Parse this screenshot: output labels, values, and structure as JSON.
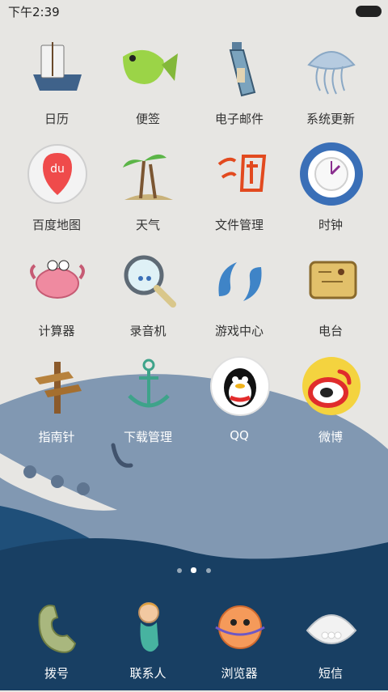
{
  "status_bar": {
    "time": "下午2:39",
    "battery_icon": "battery-icon"
  },
  "apps": [
    {
      "label": "日历",
      "icon": "calendar-boat-icon"
    },
    {
      "label": "便签",
      "icon": "fish-icon"
    },
    {
      "label": "电子邮件",
      "icon": "bottle-icon"
    },
    {
      "label": "系统更新",
      "icon": "jellyfish-icon"
    },
    {
      "label": "百度地图",
      "icon": "baidu-map-icon"
    },
    {
      "label": "天气",
      "icon": "palm-tree-icon"
    },
    {
      "label": "文件管理",
      "icon": "taobao-tao-icon"
    },
    {
      "label": "时钟",
      "icon": "life-ring-clock-icon"
    },
    {
      "label": "计算器",
      "icon": "crab-icon"
    },
    {
      "label": "录音机",
      "icon": "magnifier-icon"
    },
    {
      "label": "游戏中心",
      "icon": "dolphins-icon"
    },
    {
      "label": "电台",
      "icon": "treasure-map-icon"
    },
    {
      "label": "指南针",
      "icon": "signpost-icon"
    },
    {
      "label": "下载管理",
      "icon": "anchor-icon"
    },
    {
      "label": "QQ",
      "icon": "qq-penguin-icon"
    },
    {
      "label": "微博",
      "icon": "weibo-icon"
    }
  ],
  "page_indicator": {
    "pages": 3,
    "current": 2
  },
  "dock": [
    {
      "label": "拨号",
      "icon": "phone-icon"
    },
    {
      "label": "联系人",
      "icon": "mermaid-icon"
    },
    {
      "label": "浏览器",
      "icon": "pufferfish-icon"
    },
    {
      "label": "短信",
      "icon": "shell-pearl-icon"
    }
  ],
  "colors": {
    "background": "#e7e6e3",
    "whale": "#7f93ab",
    "sea": "#1f4f79"
  }
}
